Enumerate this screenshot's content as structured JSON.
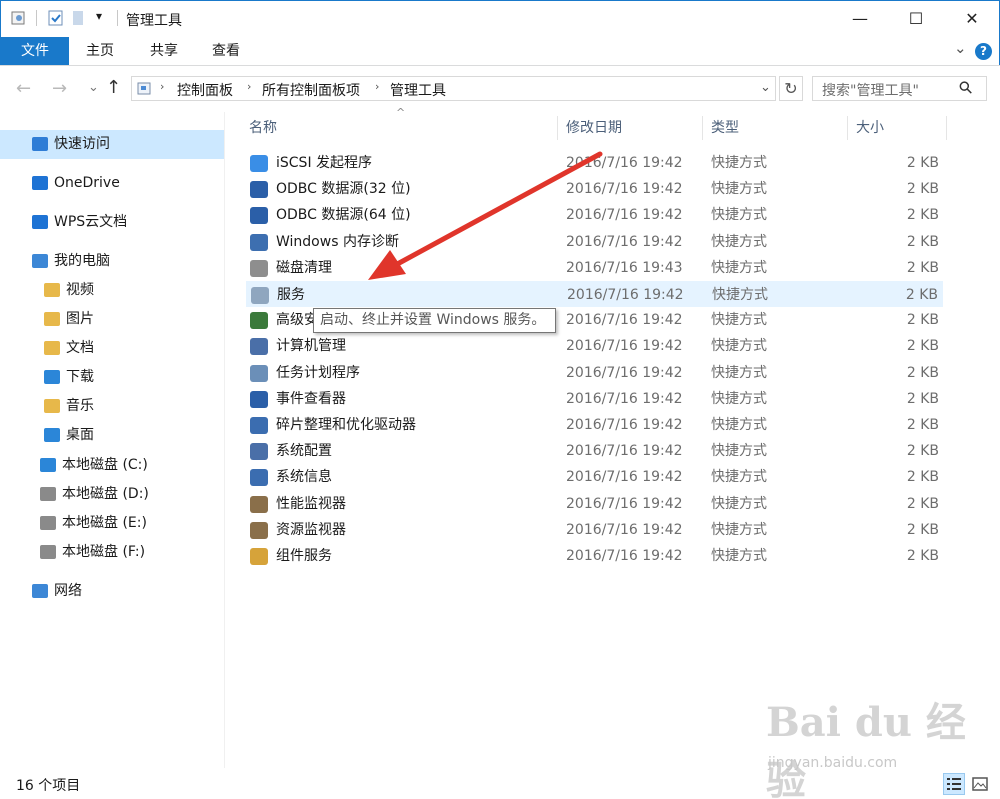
{
  "window": {
    "title": "管理工具",
    "minimize": "—",
    "maximize": "☐",
    "close": "✕"
  },
  "ribbon": {
    "tabs": [
      "文件",
      "主页",
      "共享",
      "查看"
    ],
    "expand": "⌄",
    "help": "?"
  },
  "nav": {
    "back": "←",
    "forward": "→",
    "recent": "⌄",
    "up": "↑",
    "breadcrumb": [
      "控制面板",
      "所有控制面板项",
      "管理工具"
    ],
    "crumb_sep": "›",
    "dropdown": "⌄",
    "refresh": "↻",
    "search_placeholder": "搜索\"管理工具\"",
    "search_icon": "⚲"
  },
  "sidebar": [
    {
      "label": "快速访问",
      "icon": "star-icon",
      "color": "#2f7dd6"
    },
    {
      "label": "OneDrive",
      "icon": "cloud-icon",
      "color": "#1e73d4"
    },
    {
      "label": "WPS云文档",
      "icon": "cloud-outline-icon",
      "color": "#1e73d4"
    },
    {
      "label": "我的电脑",
      "icon": "computer-icon",
      "color": "#3c87d6"
    },
    {
      "label": "视频",
      "icon": "video-folder-icon",
      "color": "#e7b84a"
    },
    {
      "label": "图片",
      "icon": "picture-folder-icon",
      "color": "#e7b84a"
    },
    {
      "label": "文档",
      "icon": "document-folder-icon",
      "color": "#e7b84a"
    },
    {
      "label": "下载",
      "icon": "download-folder-icon",
      "color": "#2b86d8"
    },
    {
      "label": "音乐",
      "icon": "music-folder-icon",
      "color": "#e7b84a"
    },
    {
      "label": "桌面",
      "icon": "desktop-folder-icon",
      "color": "#2b86d8"
    },
    {
      "label": "本地磁盘 (C:)",
      "icon": "windows-drive-icon",
      "color": "#2b86d8"
    },
    {
      "label": "本地磁盘 (D:)",
      "icon": "drive-icon",
      "color": "#8a8a8a"
    },
    {
      "label": "本地磁盘 (E:)",
      "icon": "drive-icon",
      "color": "#8a8a8a"
    },
    {
      "label": "本地磁盘 (F:)",
      "icon": "drive-icon",
      "color": "#8a8a8a"
    },
    {
      "label": "网络",
      "icon": "network-icon",
      "color": "#3c87d6"
    }
  ],
  "columns": {
    "name": "名称",
    "date": "修改日期",
    "type": "类型",
    "size": "大小",
    "sort_indicator": "^"
  },
  "files": [
    {
      "name": "iSCSI 发起程序",
      "date": "2016/7/16 19:42",
      "type": "快捷方式",
      "size": "2 KB"
    },
    {
      "name": "ODBC 数据源(32 位)",
      "date": "2016/7/16 19:42",
      "type": "快捷方式",
      "size": "2 KB"
    },
    {
      "name": "ODBC 数据源(64 位)",
      "date": "2016/7/16 19:42",
      "type": "快捷方式",
      "size": "2 KB"
    },
    {
      "name": "Windows 内存诊断",
      "date": "2016/7/16 19:42",
      "type": "快捷方式",
      "size": "2 KB"
    },
    {
      "name": "磁盘清理",
      "date": "2016/7/16 19:43",
      "type": "快捷方式",
      "size": "2 KB"
    },
    {
      "name": "服务",
      "date": "2016/7/16 19:42",
      "type": "快捷方式",
      "size": "2 KB"
    },
    {
      "name": "高级安",
      "date": "2016/7/16 19:42",
      "type": "快捷方式",
      "size": "2 KB"
    },
    {
      "name": "计算机管理",
      "date": "2016/7/16 19:42",
      "type": "快捷方式",
      "size": "2 KB"
    },
    {
      "name": "任务计划程序",
      "date": "2016/7/16 19:42",
      "type": "快捷方式",
      "size": "2 KB"
    },
    {
      "name": "事件查看器",
      "date": "2016/7/16 19:42",
      "type": "快捷方式",
      "size": "2 KB"
    },
    {
      "name": "碎片整理和优化驱动器",
      "date": "2016/7/16 19:42",
      "type": "快捷方式",
      "size": "2 KB"
    },
    {
      "name": "系统配置",
      "date": "2016/7/16 19:42",
      "type": "快捷方式",
      "size": "2 KB"
    },
    {
      "name": "系统信息",
      "date": "2016/7/16 19:42",
      "type": "快捷方式",
      "size": "2 KB"
    },
    {
      "name": "性能监视器",
      "date": "2016/7/16 19:42",
      "type": "快捷方式",
      "size": "2 KB"
    },
    {
      "name": "资源监视器",
      "date": "2016/7/16 19:42",
      "type": "快捷方式",
      "size": "2 KB"
    },
    {
      "name": "组件服务",
      "date": "2016/7/16 19:42",
      "type": "快捷方式",
      "size": "2 KB"
    }
  ],
  "tooltip": "启动、终止并设置 Windows 服务。",
  "status": {
    "item_count": "16 个项目"
  },
  "watermark": {
    "logo": "Bai du 经验",
    "url": "jingyan.baidu.com"
  },
  "colors": {
    "accent": "#1979ca",
    "hover": "#e5f3ff",
    "selected": "#cce8ff",
    "arrow": "#e0352b"
  }
}
